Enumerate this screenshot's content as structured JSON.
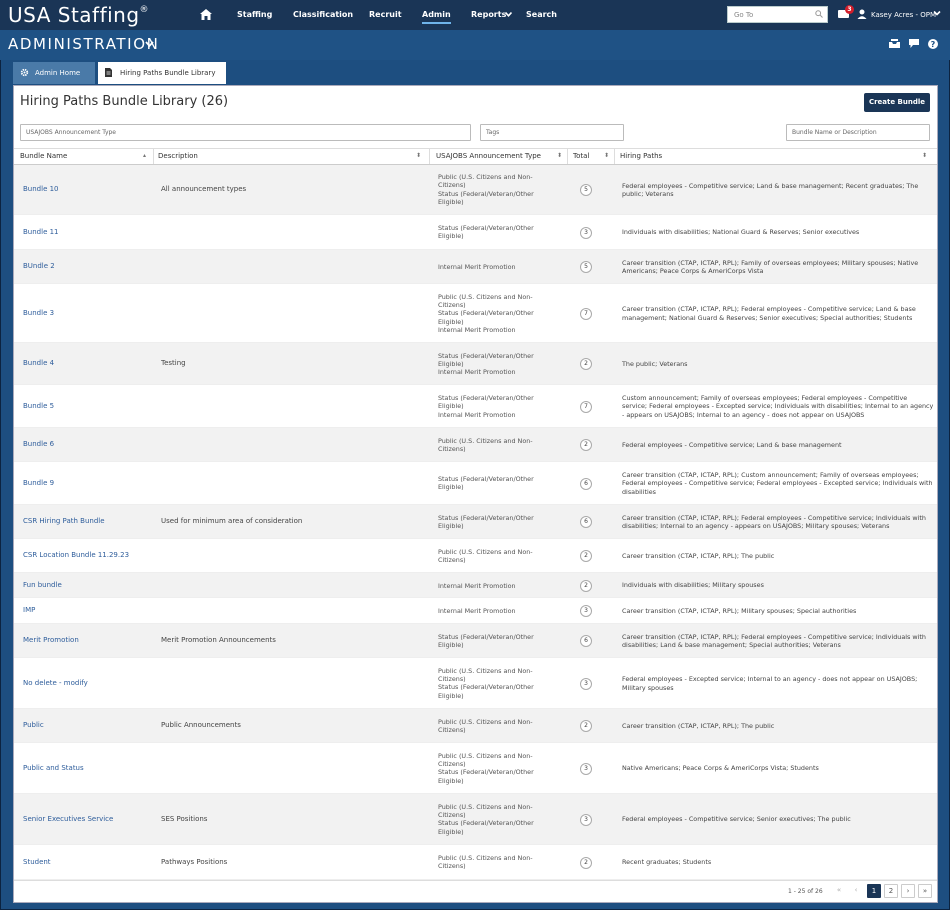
{
  "app": {
    "logo": "USA Staffing",
    "logo_mark": "®"
  },
  "topnav": {
    "home_icon": "home-icon",
    "items": [
      "Staffing",
      "Classification",
      "Recruit",
      "Admin",
      "Reports",
      "Search"
    ],
    "active": "Admin",
    "goto_placeholder": "Go To",
    "mail_count": "3",
    "user": "Kasey Acres - OPM"
  },
  "header": {
    "title": "ADMINISTRATION"
  },
  "tabs": [
    "Admin Home",
    "Hiring Paths Bundle Library"
  ],
  "page": {
    "title": "Hiring Paths Bundle Library (26)",
    "create_button": "Create Bundle"
  },
  "filters": {
    "type": "USAJOBS Announcement Type",
    "tags": "Tags",
    "name": "Bundle Name or Description"
  },
  "columns": [
    "Bundle Name",
    "Description",
    "USAJOBS Announcement Type",
    "Total",
    "Hiring Paths"
  ],
  "rows": [
    {
      "name": "Bundle 10",
      "desc": "All announcement types",
      "type": [
        "Public (U.S. Citizens and Non-Citizens)",
        "Status (Federal/Veteran/Other Eligible)"
      ],
      "total": "5",
      "paths": "Federal employees - Competitive service; Land & base management; Recent graduates; The public; Veterans"
    },
    {
      "name": "Bundle 11",
      "desc": "",
      "type": [
        "Status (Federal/Veteran/Other Eligible)"
      ],
      "total": "3",
      "paths": "Individuals with disabilities; National Guard & Reserves; Senior executives"
    },
    {
      "name": "BUndle 2",
      "desc": "",
      "type": [
        "Internal Merit Promotion"
      ],
      "total": "5",
      "paths": "Career transition (CTAP, ICTAP, RPL); Family of overseas employees; Military spouses; Native Americans; Peace Corps & AmeriCorps Vista"
    },
    {
      "name": "Bundle 3",
      "desc": "",
      "type": [
        "Public (U.S. Citizens and Non-Citizens)",
        "Status (Federal/Veteran/Other Eligible)",
        "Internal Merit Promotion"
      ],
      "total": "7",
      "paths": "Career transition (CTAP, ICTAP, RPL); Federal employees - Competitive service; Land & base management; National Guard & Reserves; Senior executives; Special authorities; Students"
    },
    {
      "name": "Bundle 4",
      "desc": "Testing",
      "type": [
        "Status (Federal/Veteran/Other Eligible)",
        "Internal Merit Promotion"
      ],
      "total": "2",
      "paths": "The public; Veterans"
    },
    {
      "name": "Bundle 5",
      "desc": "",
      "type": [
        "Status (Federal/Veteran/Other Eligible)",
        "Internal Merit Promotion"
      ],
      "total": "7",
      "paths": "Custom announcement; Family of overseas employees; Federal employees - Competitive service; Federal employees - Excepted service; Individuals with disabilities; Internal to an agency - appears on USAJOBS; Internal to an agency - does not appear on USAJOBS"
    },
    {
      "name": "Bundle 6",
      "desc": "",
      "type": [
        "Public (U.S. Citizens and Non-Citizens)"
      ],
      "total": "2",
      "paths": "Federal employees - Competitive service; Land & base management"
    },
    {
      "name": "Bundle 9",
      "desc": "",
      "type": [
        "Status (Federal/Veteran/Other Eligible)"
      ],
      "total": "6",
      "paths": "Career transition (CTAP, ICTAP, RPL); Custom announcement; Family of overseas employees; Federal employees - Competitive service; Federal employees - Excepted service; Individuals with disabilities"
    },
    {
      "name": "CSR Hiring Path Bundle",
      "desc": "Used for minimum area of consideration",
      "type": [
        "Status (Federal/Veteran/Other Eligible)"
      ],
      "total": "6",
      "paths": "Career transition (CTAP, ICTAP, RPL); Federal employees - Competitive service; Individuals with disabilities; Internal to an agency - appears on USAJOBS; Military spouses; Veterans"
    },
    {
      "name": "CSR Location Bundle 11.29.23",
      "desc": "",
      "type": [
        "Public (U.S. Citizens and Non-Citizens)"
      ],
      "total": "2",
      "paths": "Career transition (CTAP, ICTAP, RPL); The public"
    },
    {
      "name": "Fun bundle",
      "desc": "",
      "type": [
        "Internal Merit Promotion"
      ],
      "total": "2",
      "paths": "Individuals with disabilities; Military spouses"
    },
    {
      "name": "IMP",
      "desc": "",
      "type": [
        "Internal Merit Promotion"
      ],
      "total": "3",
      "paths": "Career transition (CTAP, ICTAP, RPL); Military spouses; Special authorities"
    },
    {
      "name": "Merit Promotion",
      "desc": "Merit Promotion Announcements",
      "type": [
        "Status (Federal/Veteran/Other Eligible)"
      ],
      "total": "6",
      "paths": "Career transition (CTAP, ICTAP, RPL); Federal employees - Competitive service; Individuals with disabilities; Land & base management; Special authorities; Veterans"
    },
    {
      "name": "No delete - modify",
      "desc": "",
      "type": [
        "Public (U.S. Citizens and Non-Citizens)",
        "Status (Federal/Veteran/Other Eligible)"
      ],
      "total": "3",
      "paths": "Federal employees - Excepted service; Internal to an agency - does not appear on USAJOBS; Military spouses"
    },
    {
      "name": "Public",
      "desc": "Public Announcements",
      "type": [
        "Public (U.S. Citizens and Non-Citizens)"
      ],
      "total": "2",
      "paths": "Career transition (CTAP, ICTAP, RPL); The public"
    },
    {
      "name": "Public and Status",
      "desc": "",
      "type": [
        "Public (U.S. Citizens and Non-Citizens)",
        "Status (Federal/Veteran/Other Eligible)"
      ],
      "total": "3",
      "paths": "Native Americans; Peace Corps & AmeriCorps Vista; Students"
    },
    {
      "name": "Senior Executives Service",
      "desc": "SES Positions",
      "type": [
        "Public (U.S. Citizens and Non-Citizens)",
        "Status (Federal/Veteran/Other Eligible)"
      ],
      "total": "3",
      "paths": "Federal employees - Competitive service; Senior executives; The public"
    },
    {
      "name": "Student",
      "desc": "Pathways Positions",
      "type": [
        "Public (U.S. Citizens and Non-Citizens)"
      ],
      "total": "2",
      "paths": "Recent graduates; Students"
    }
  ],
  "pager": {
    "summary": "1 - 25 of 26",
    "first": "«",
    "prev": "‹",
    "pages": [
      "1",
      "2"
    ],
    "next": "›",
    "last": "»"
  }
}
